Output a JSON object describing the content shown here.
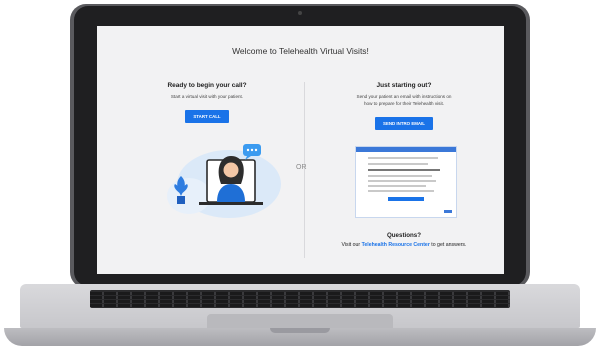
{
  "page": {
    "title": "Welcome to Telehealth Virtual Visits!"
  },
  "left": {
    "heading": "Ready to begin your call?",
    "body": "Start a virtual visit with your patient.",
    "button": "START CALL"
  },
  "divider": {
    "or": "OR"
  },
  "right": {
    "heading": "Just starting out?",
    "body_line1": "Send your patient an email with instructions on",
    "body_line2": "how to prepare for their Telehealth visit.",
    "button": "SEND INTRO EMAIL"
  },
  "footer": {
    "question": "Questions?",
    "prefix": "Visit our ",
    "link": "Telehealth Resource Center",
    "suffix": " to get answers."
  },
  "colors": {
    "accent": "#1a73e8",
    "illustration_blue": "#cfe2f7",
    "illustration_dark": "#1f5fbf"
  }
}
